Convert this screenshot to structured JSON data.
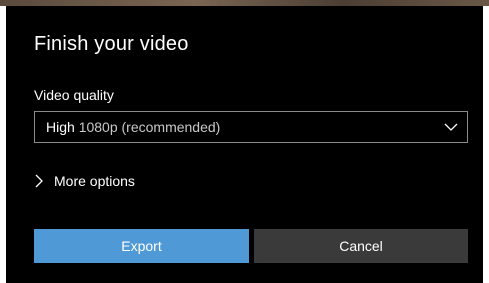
{
  "dialog": {
    "title": "Finish your video",
    "video_quality": {
      "label": "Video quality",
      "selected_primary": "High",
      "selected_secondary": "1080p (recommended)"
    },
    "more_options_label": "More options",
    "buttons": {
      "export_label": "Export",
      "cancel_label": "Cancel"
    }
  },
  "colors": {
    "dialog_background": "#000000",
    "primary_button": "#4f9ad6",
    "secondary_button": "#3a3a3a",
    "text": "#ffffff"
  },
  "icons": {
    "dropdown": "chevron-down-icon",
    "expander": "chevron-right-icon"
  }
}
